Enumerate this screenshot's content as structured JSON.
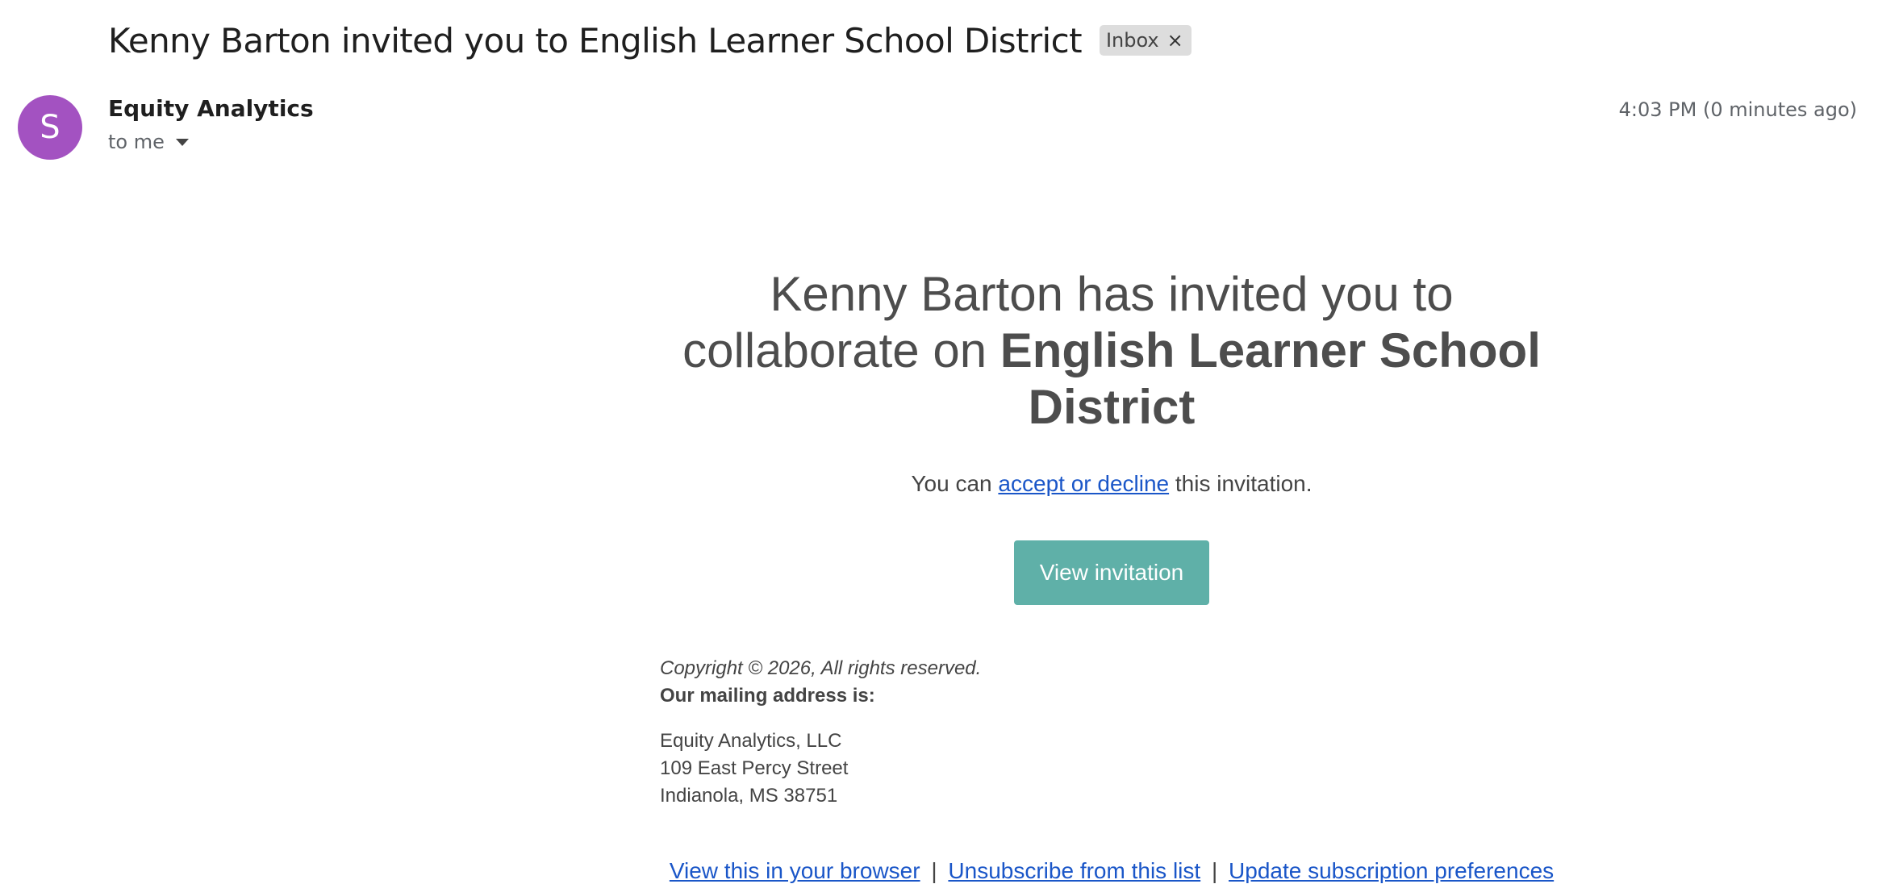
{
  "header": {
    "subject": "Kenny Barton invited you to English Learner School District",
    "label": "Inbox",
    "label_remove": "×"
  },
  "sender": {
    "avatar_letter": "S",
    "avatar_color": "#a352c1",
    "name": "Equity Analytics",
    "recipient": "to me",
    "time": "4:03 PM (0 minutes ago)"
  },
  "body": {
    "headline_prefix": "Kenny Barton has invited you to collaborate on",
    "headline_bold": "English Learner School District",
    "invite_before": "You can",
    "invite_link": "accept or decline",
    "invite_after": "this invitation.",
    "button_label": "View invitation",
    "button_color": "#5fb0a8"
  },
  "footer": {
    "copyright": "Copyright © 2026, All rights reserved.",
    "mailing_heading": "Our mailing address is:",
    "address": [
      "Equity Analytics, LLC",
      "109 East Percy Street",
      "Indianola, MS 38751"
    ],
    "links": [
      "View this in your browser",
      "Unsubscribe from this list",
      "Update subscription preferences"
    ],
    "separator": "|"
  }
}
